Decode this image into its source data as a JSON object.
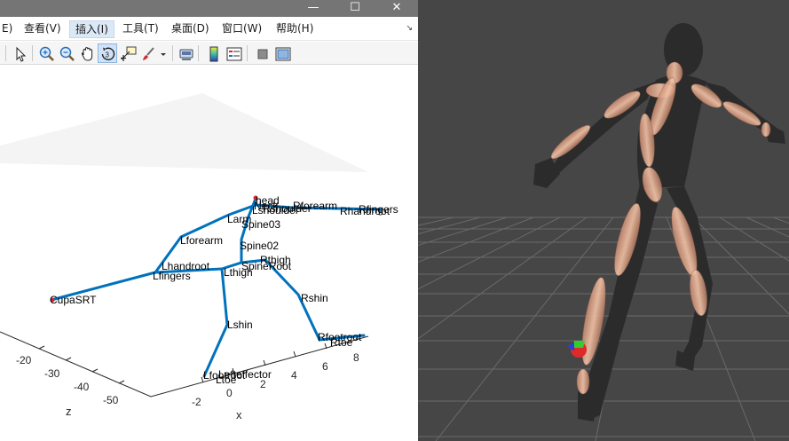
{
  "window": {
    "minimize_glyph": "—",
    "maximize_glyph": "☐",
    "close_glyph": "✕"
  },
  "menu": {
    "items": [
      {
        "label": "E)",
        "active": false
      },
      {
        "label": "查看(V)",
        "active": false
      },
      {
        "label": "插入(I)",
        "active": true
      },
      {
        "label": "工具(T)",
        "active": false
      },
      {
        "label": "桌面(D)",
        "active": false
      },
      {
        "label": "窗口(W)",
        "active": false
      },
      {
        "label": "帮助(H)",
        "active": false
      }
    ],
    "overflow_glyph": "↘"
  },
  "toolbar": {
    "icons": [
      "select-arrow-icon",
      "zoom-in-icon",
      "zoom-out-icon",
      "pan-hand-icon",
      "rotate-3d-icon",
      "data-cursor-icon",
      "brush-icon",
      "link-plot-icon",
      "colorbar-icon",
      "legend-icon",
      "hide-plot-tools-icon",
      "show-plot-tools-icon"
    ],
    "active": "rotate-3d-icon"
  },
  "plot": {
    "skeleton_color": "#0072bd",
    "joints": [
      {
        "label": "head"
      },
      {
        "label": "Neck"
      },
      {
        "label": "Lshoulder"
      },
      {
        "label": "Rshoulder"
      },
      {
        "label": "Rforearm"
      },
      {
        "label": "Rfingers"
      },
      {
        "label": "Rhandroot"
      },
      {
        "label": "Larm"
      },
      {
        "label": "Lforearm"
      },
      {
        "label": "Spine03"
      },
      {
        "label": "Spine02"
      },
      {
        "label": "Lhandroot"
      },
      {
        "label": "Lfingers"
      },
      {
        "label": "SpineRoot"
      },
      {
        "label": "Lthigh"
      },
      {
        "label": "Rthigh"
      },
      {
        "label": "Rshin"
      },
      {
        "label": "Lshin"
      },
      {
        "label": "Rfootroot"
      },
      {
        "label": "Rtoe"
      },
      {
        "label": "Lfootroot"
      },
      {
        "label": "Lefteffector"
      },
      {
        "label": "Ltoe"
      },
      {
        "label": "CupaSRT"
      }
    ],
    "z_axis": {
      "label": "z",
      "ticks": [
        "-20",
        "-30",
        "-40",
        "-50"
      ]
    },
    "x_axis": {
      "label": "x",
      "ticks": [
        "-2",
        "0",
        "2",
        "4",
        "6",
        "8"
      ]
    }
  },
  "viewport": {
    "background": "#464646",
    "grid_color": "#6a6a6a",
    "figure_color": "#2b2b2b",
    "bone_color": "#e8b196"
  }
}
